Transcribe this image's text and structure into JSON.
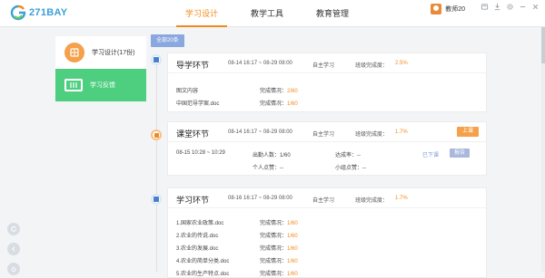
{
  "app": {
    "logo_text": "271BAY",
    "username": "教师20"
  },
  "nav": {
    "tabs": [
      {
        "label": "学习设计",
        "active": true
      },
      {
        "label": "教学工具",
        "active": false
      },
      {
        "label": "教育管理",
        "active": false
      }
    ]
  },
  "sidebar": {
    "items": [
      {
        "label": "学习设计(17份)",
        "icon": "grid-icon",
        "active": false
      },
      {
        "label": "学习反馈",
        "icon": "board-icon",
        "active": true
      }
    ]
  },
  "filter": {
    "all_label": "全部20条"
  },
  "cards": [
    {
      "title": "导学环节",
      "date_range": "08-14 16:17 ~ 08-29 08:00",
      "mode": "自主学习",
      "rate_label": "班级完成度：",
      "rate_value": "2.5%",
      "rows": [
        {
          "name": "图文内容",
          "status_label": "完成情况：",
          "status_value": "2/60"
        },
        {
          "name": "中国范导学案.doc",
          "status_label": "完成情况：",
          "status_value": "1/60"
        }
      ]
    },
    {
      "title": "课堂环节",
      "date_range": "08-14 16:17 ~ 08-29 08:00",
      "mode": "自主学习",
      "rate_label": "班级完成度：",
      "rate_value": "1.7%",
      "button_label": "上课",
      "session_time": "08-15 10:28 ~ 10:29",
      "attend_label": "出勤人数：",
      "attend_value": "1/60",
      "reach_label": "达成率：",
      "reach_value": "--",
      "personal_label": "个人点赞：",
      "personal_value": "--",
      "group_label": "小组点赞：",
      "group_value": "--",
      "ended_label": "已下课",
      "report_label": "报告"
    },
    {
      "title": "学习环节",
      "date_range": "08-16 16:17 ~ 08-29 08:00",
      "mode": "自主学习",
      "rate_label": "班级完成度：",
      "rate_value": "1.7%",
      "rows": [
        {
          "name": "1.国家农业政策.doc",
          "status_label": "完成情况：",
          "status_value": "1/60"
        },
        {
          "name": "2.农业的传说.doc",
          "status_label": "完成情况：",
          "status_value": "1/60"
        },
        {
          "name": "3.农业的发展.doc",
          "status_label": "完成情况：",
          "status_value": "1/60"
        },
        {
          "name": "4.农业的简单分类.doc",
          "status_label": "完成情况：",
          "status_value": "1/60"
        },
        {
          "name": "5.农业的生产特点.doc",
          "status_label": "完成情况：",
          "status_value": "1/60"
        }
      ]
    }
  ],
  "colors": {
    "accent": "#f08a1c",
    "green": "#4ecf80",
    "blue": "#4a7fcf"
  }
}
